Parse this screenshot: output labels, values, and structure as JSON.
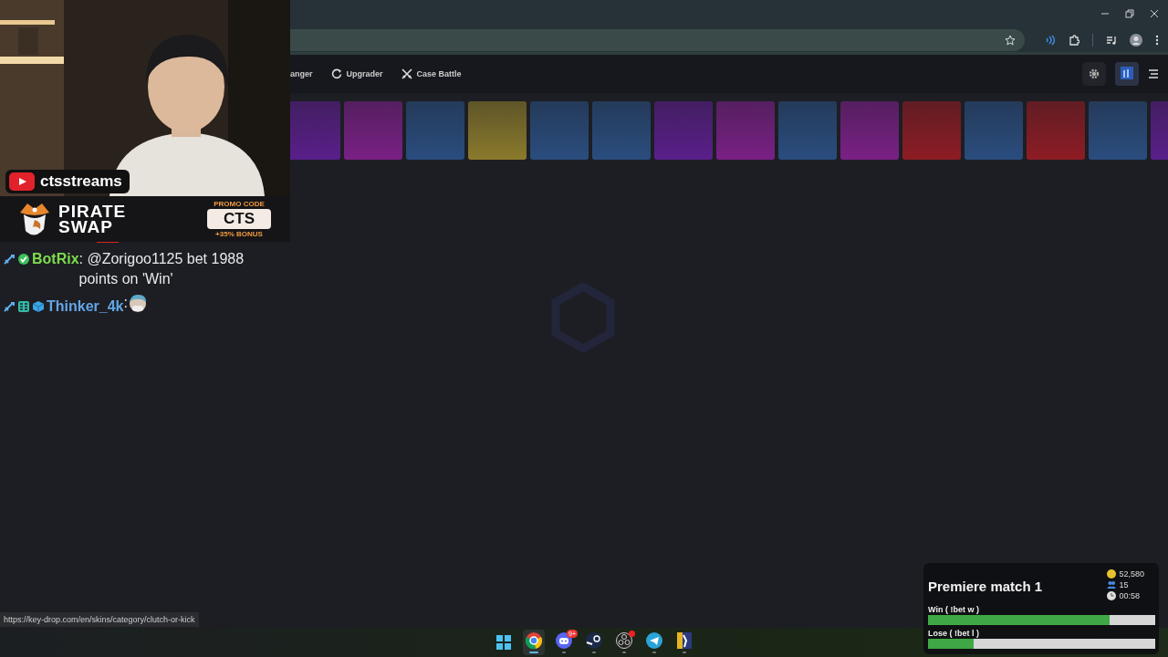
{
  "channel_badge": {
    "name": "ctsstreams"
  },
  "promo_banner": {
    "brand_line_1": "PIRATE",
    "brand_line_2": "SWAP",
    "promo_label": "PROMO CODE",
    "code": "CTS",
    "bonus": "+35% BONUS"
  },
  "chat": [
    {
      "user": "BotRix",
      "color": "#7ddc4b",
      "badges": [
        {
          "kind": "moderator"
        },
        {
          "kind": "verified"
        }
      ],
      "message": ": @Zorigoo1125 bet 1988 points on 'Win'",
      "emote": false
    },
    {
      "user": "Thinker_4k",
      "color": "#62a6e6",
      "badges": [
        {
          "kind": "moderator"
        },
        {
          "kind": "bits"
        },
        {
          "kind": "cube"
        }
      ],
      "message": ":",
      "emote": true
    }
  ],
  "status_url": "https://key-drop.com/en/skins/category/clutch-or-kick",
  "nav": [
    {
      "label": "anger",
      "kind": "plain"
    },
    {
      "label": "Upgrader",
      "kind": "upgrader"
    },
    {
      "label": "Case Battle",
      "kind": "battle"
    }
  ],
  "tiles": [
    {
      "color": "#5a1f8a"
    },
    {
      "color": "#7a2086"
    },
    {
      "color": "#2a4d7e"
    },
    {
      "color": "#8a7a2c"
    },
    {
      "color": "#2a4d7e"
    },
    {
      "color": "#2a4d7e"
    },
    {
      "color": "#5a1f8a"
    },
    {
      "color": "#7a2086"
    },
    {
      "color": "#2a4d7e"
    },
    {
      "color": "#7a2086"
    },
    {
      "color": "#8e1c24"
    },
    {
      "color": "#2a4d7e"
    },
    {
      "color": "#8e1c24"
    },
    {
      "color": "#2a4d7e"
    },
    {
      "color": "#5a1f8a"
    }
  ],
  "prediction": {
    "title": "Premiere match 1",
    "points": "52,580",
    "users": "15",
    "time": "00:58",
    "outcomes": [
      {
        "label": "Win ( !bet w )",
        "level": 0.8
      },
      {
        "label": "Lose ( !bet l )",
        "level": 0.2
      }
    ]
  },
  "taskbar": {
    "apps": [
      {
        "kind": "start",
        "active": false
      },
      {
        "kind": "browser",
        "active": true
      },
      {
        "kind": "chat",
        "active": false,
        "badge": "9+"
      },
      {
        "kind": "steam",
        "active": false
      },
      {
        "kind": "recorder",
        "active": false,
        "alert": true
      },
      {
        "kind": "telegram",
        "active": false
      },
      {
        "kind": "game",
        "active": false
      }
    ]
  }
}
